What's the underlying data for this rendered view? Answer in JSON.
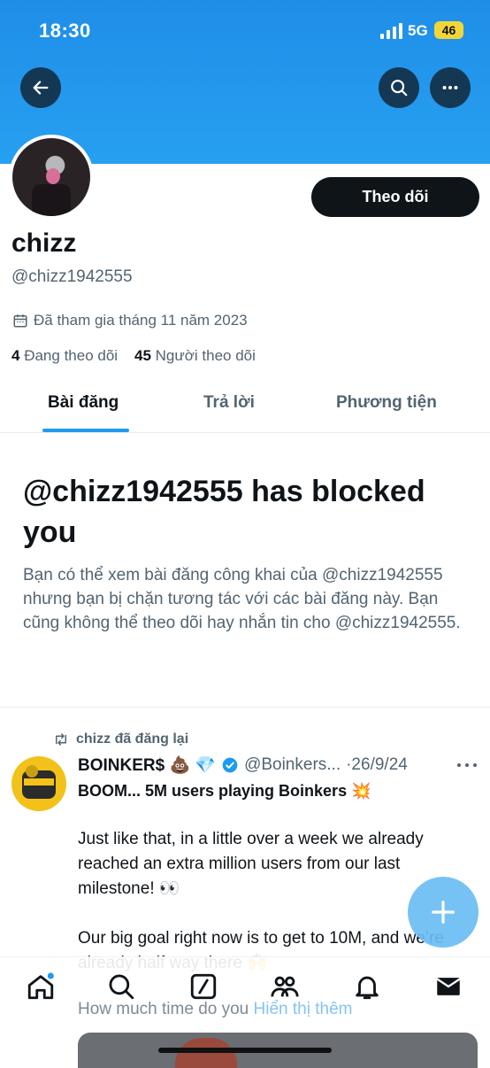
{
  "status_bar": {
    "time": "18:30",
    "network": "5G",
    "battery": "46"
  },
  "profile": {
    "display_name": "chizz",
    "handle": "@chizz1942555",
    "follow_label": "Theo dõi",
    "joined": "Đã tham gia tháng 11 năm 2023",
    "following_count": "4",
    "following_label": "Đang theo dõi",
    "followers_count": "45",
    "followers_label": "Người theo dõi"
  },
  "tabs": [
    {
      "label": "Bài đăng",
      "active": true
    },
    {
      "label": "Trả lời",
      "active": false
    },
    {
      "label": "Phương tiện",
      "active": false
    }
  ],
  "blocked": {
    "title": "@chizz1942555 has blocked you",
    "description": "Bạn có thể xem bài đăng công khai của @chizz1942555 nhưng bạn bị chặn tương tác với các bài đăng này. Bạn cũng không thể theo dõi hay nhắn tin cho @chizz1942555."
  },
  "tweet": {
    "repost_label": "chizz đã đăng lại",
    "display_name": "BOINKER$ 💩 💎",
    "handle": "@Boinkers...",
    "date": "·26/9/24",
    "line1": "BOOM... 5M users playing Boinkers 💥",
    "paragraphs": [
      "Just like that, in a little over a week we already reached an extra million users from our last milestone! 👀",
      "Our big goal right now is to get to 10M, and we’re already half way there 🙌"
    ],
    "more_text": "How much time do you",
    "show_more": "Hiển thị thêm"
  },
  "colors": {
    "accent": "#1d9bf0",
    "banner": "#1f8ee8",
    "text": "#0f1419",
    "muted": "#536471"
  },
  "icons": [
    "back-arrow-icon",
    "search-icon",
    "more-dots-icon",
    "calendar-icon",
    "repost-icon",
    "verified-icon",
    "plus-icon",
    "home-icon",
    "explore-icon",
    "grok-icon",
    "communities-icon",
    "notifications-icon",
    "messages-icon"
  ]
}
